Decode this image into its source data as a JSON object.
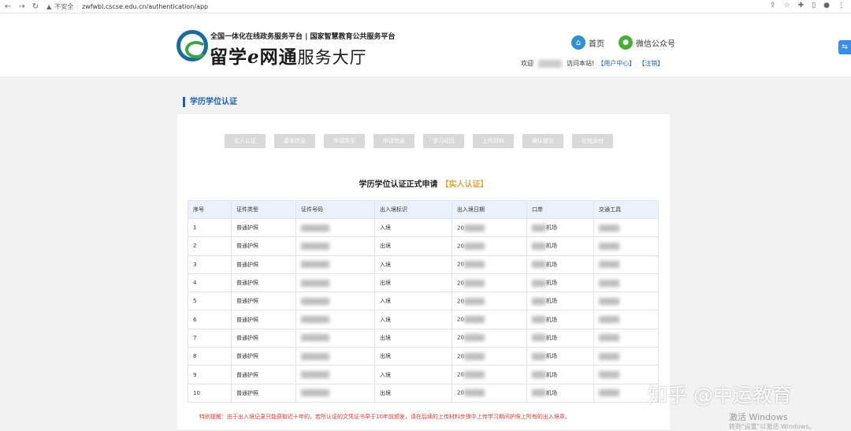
{
  "browser": {
    "insecure_label": "不安全",
    "url": "zwfwbl.cscse.edu.cn/authentication/app"
  },
  "header": {
    "subtitle": "全国一体化在线政务服务平台 | 国家智慧教育公共服务平台",
    "brand_left": "留学",
    "brand_e": "e",
    "brand_right": "网通",
    "brand_hall": "服务大厅",
    "home_link": "首页",
    "wechat_link": "微信公众号",
    "welcome_prefix": "欢迎",
    "welcome_suffix": "访问本站!",
    "user_center": "【用户中心】",
    "logout": "【注销】"
  },
  "section_title": "学历学位认证",
  "steps": [
    "实人认证",
    "基本信息",
    "申请类型",
    "申请信息",
    "学习经历",
    "上传材料",
    "确认提交",
    "在线支付"
  ],
  "form": {
    "title": "学历学位认证正式申请",
    "current_step": "【实人认证】"
  },
  "table": {
    "columns": [
      "序号",
      "证件类型",
      "证件号码",
      "出入境标识",
      "出入境日期",
      "口岸",
      "交通工具"
    ],
    "rows": [
      {
        "no": "1",
        "doc_type": "普通护照",
        "direction": "入境",
        "date_prefix": "20",
        "port_suffix": "机场"
      },
      {
        "no": "2",
        "doc_type": "普通护照",
        "direction": "出境",
        "date_prefix": "20",
        "port_suffix": "机场"
      },
      {
        "no": "3",
        "doc_type": "普通护照",
        "direction": "入境",
        "date_prefix": "20",
        "port_suffix": "机场"
      },
      {
        "no": "4",
        "doc_type": "普通护照",
        "direction": "出境",
        "date_prefix": "20",
        "port_suffix": "机场"
      },
      {
        "no": "5",
        "doc_type": "普通护照",
        "direction": "入境",
        "date_prefix": "20",
        "port_suffix": "机场"
      },
      {
        "no": "6",
        "doc_type": "普通护照",
        "direction": "入境",
        "date_prefix": "20",
        "port_suffix": "机场"
      },
      {
        "no": "7",
        "doc_type": "普通护照",
        "direction": "出境",
        "date_prefix": "20",
        "port_suffix": "机场"
      },
      {
        "no": "8",
        "doc_type": "普通护照",
        "direction": "出境",
        "date_prefix": "20",
        "port_suffix": "机场"
      },
      {
        "no": "9",
        "doc_type": "普通护照",
        "direction": "入境",
        "date_prefix": "20",
        "port_suffix": "机场"
      },
      {
        "no": "10",
        "doc_type": "普通护照",
        "direction": "出境",
        "date_prefix": "20",
        "port_suffix": "机场"
      }
    ]
  },
  "note": "特别提醒：由于出入境记录只能获取近十年的，若所认证的文凭证书早于10年前颁发，请在后续的上传材料步骤中上传学习期间护照上所有的出入境章。",
  "watermark": {
    "zhihu": "知乎 @中运教育",
    "activate": "激活 Windows",
    "activate_sub": "转到\"设置\"以激活 Windows。"
  }
}
